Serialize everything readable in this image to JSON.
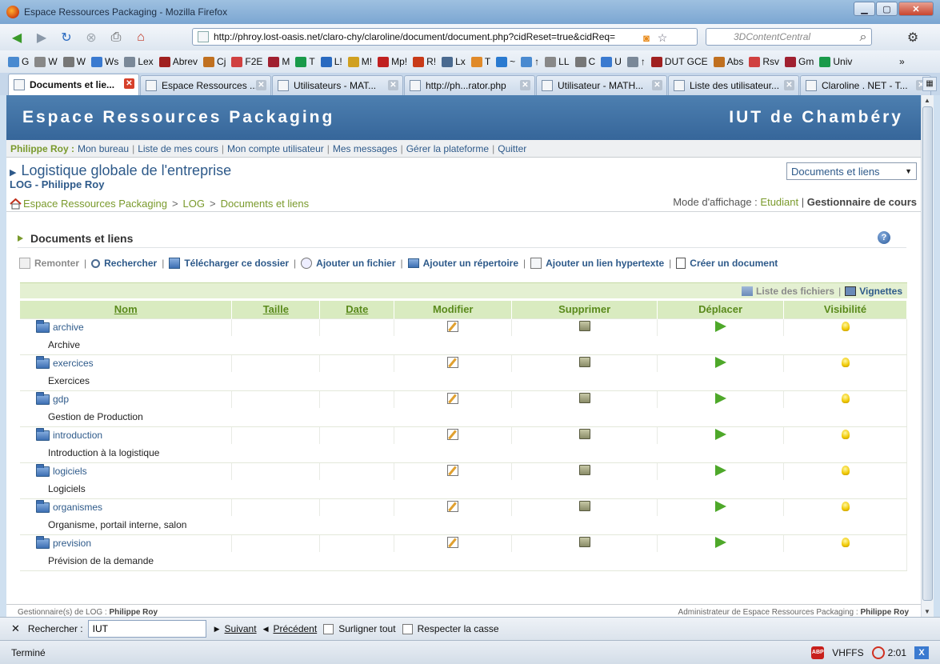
{
  "window": {
    "title": "Espace Ressources Packaging - Mozilla Firefox"
  },
  "browser": {
    "url": "http://phroy.lost-oasis.net/claro-chy/claroline/document/document.php?cidReset=true&cidReq=",
    "search_placeholder": "3DContentCentral",
    "bookmarks": [
      "G",
      "W",
      "W",
      "Ws",
      "Lex",
      "Abrev",
      "Cj",
      "F2E",
      "M",
      "T",
      "L!",
      "M!",
      "Mp!",
      "R!",
      "Lx",
      "T",
      "~",
      "↑",
      "LL",
      "C",
      "U",
      "↑",
      "DUT GCE",
      "Abs",
      "Rsv",
      "Gm",
      "Univ"
    ],
    "bookmarks_more": "»",
    "tabs": [
      {
        "label": "Documents et lie..."
      },
      {
        "label": "Espace Ressources ..."
      },
      {
        "label": "Utilisateurs - MAT..."
      },
      {
        "label": "http://ph...rator.php"
      },
      {
        "label": "Utilisateur - MATH..."
      },
      {
        "label": "Liste des utilisateur..."
      },
      {
        "label": "Claroline . NET - T..."
      }
    ]
  },
  "site": {
    "name": "Espace Ressources Packaging",
    "institution": "IUT de Chambéry"
  },
  "userbar": {
    "user": "Philippe Roy :",
    "links": [
      "Mon bureau",
      "Liste de mes cours",
      "Mon compte utilisateur",
      "Mes messages",
      "Gérer la plateforme",
      "Quitter"
    ]
  },
  "course": {
    "title": "Logistique globale de l'entreprise",
    "code": "LOG - Philippe Roy",
    "tool_select": "Documents et liens"
  },
  "breadcrumb": [
    "Espace Ressources Packaging",
    "LOG",
    "Documents et liens"
  ],
  "mode": {
    "label": "Mode d'affichage :",
    "student": "Etudiant",
    "manager": "Gestionnaire de cours"
  },
  "section": {
    "title": "Documents et liens"
  },
  "actions": {
    "up": "Remonter",
    "search": "Rechercher",
    "download": "Télécharger ce dossier",
    "add_file": "Ajouter un fichier",
    "add_dir": "Ajouter un répertoire",
    "add_link": "Ajouter un lien hypertexte",
    "create_doc": "Créer un document"
  },
  "views": {
    "list": "Liste des fichiers",
    "thumbs": "Vignettes"
  },
  "table": {
    "headers": {
      "name": "Nom",
      "size": "Taille",
      "date": "Date",
      "edit": "Modifier",
      "delete": "Supprimer",
      "move": "Déplacer",
      "visibility": "Visibilité"
    },
    "rows": [
      {
        "name": "archive",
        "desc": "Archive"
      },
      {
        "name": "exercices",
        "desc": "Exercices"
      },
      {
        "name": "gdp",
        "desc": "Gestion de Production"
      },
      {
        "name": "introduction",
        "desc": "Introduction à la logistique"
      },
      {
        "name": "logiciels",
        "desc": "Logiciels"
      },
      {
        "name": "organismes",
        "desc": "Organisme, portail interne, salon"
      },
      {
        "name": "prevision",
        "desc": "Prévision de la demande"
      }
    ]
  },
  "footer": {
    "left_label": "Gestionnaire(s) de LOG :",
    "left_name": "Philippe Roy",
    "right_label": "Administrateur de Espace Ressources Packaging :",
    "right_name": "Philippe Roy"
  },
  "findbar": {
    "label": "Rechercher :",
    "value": "IUT",
    "next": "Suivant",
    "prev": "Précédent",
    "highlight": "Surligner tout",
    "matchcase": "Respecter la casse"
  },
  "status": {
    "text": "Terminé",
    "vhffs": "VHFFS",
    "time": "2:01"
  }
}
